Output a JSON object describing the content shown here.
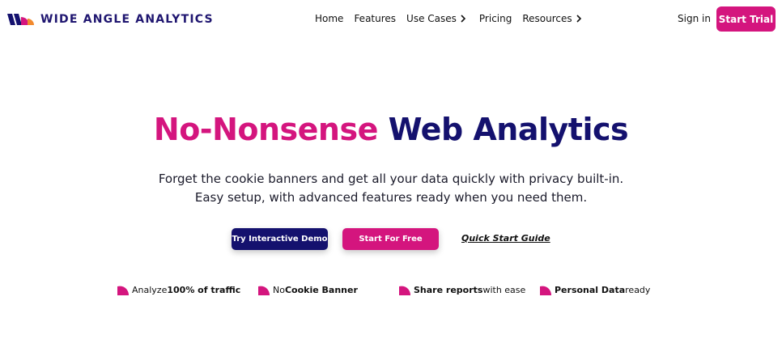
{
  "brand": {
    "name": "WIDE ANGLE ANALYTICS",
    "colors": {
      "pink": "#d4157e",
      "navy": "#14116e",
      "orange": "#f28a2e"
    }
  },
  "nav": {
    "items": [
      {
        "label": "Home",
        "has_chevron": false
      },
      {
        "label": "Features",
        "has_chevron": false
      },
      {
        "label": "Use Cases",
        "has_chevron": true
      },
      {
        "label": "Pricing",
        "has_chevron": false
      },
      {
        "label": "Resources",
        "has_chevron": true
      }
    ],
    "sign_in": "Sign in",
    "start_trial": "Start Trial"
  },
  "hero": {
    "headline_pink": "No-Nonsense",
    "headline_navy": "Web Analytics",
    "subtitle_line1": "Forget the cookie banners and get all your data quickly with privacy built-in.",
    "subtitle_line2": "Easy setup, with advanced features ready when you need them.",
    "demo_button": "Try Interactive Demo",
    "free_button": "Start For Free",
    "guide_link": "Quick Start Guide"
  },
  "features": [
    {
      "pre": "Analyze ",
      "bold": "100% of traffic",
      "post": "",
      "icon": "quarter-circle-icon"
    },
    {
      "pre": "No ",
      "bold": "Cookie Banner",
      "post": "",
      "icon": "quarter-circle-icon"
    },
    {
      "pre": "",
      "bold": "Share reports",
      "post": " with ease",
      "icon": "quarter-circle-icon"
    },
    {
      "pre": "",
      "bold": "Personal Data",
      "post": " ready",
      "icon": "quarter-circle-icon"
    }
  ]
}
